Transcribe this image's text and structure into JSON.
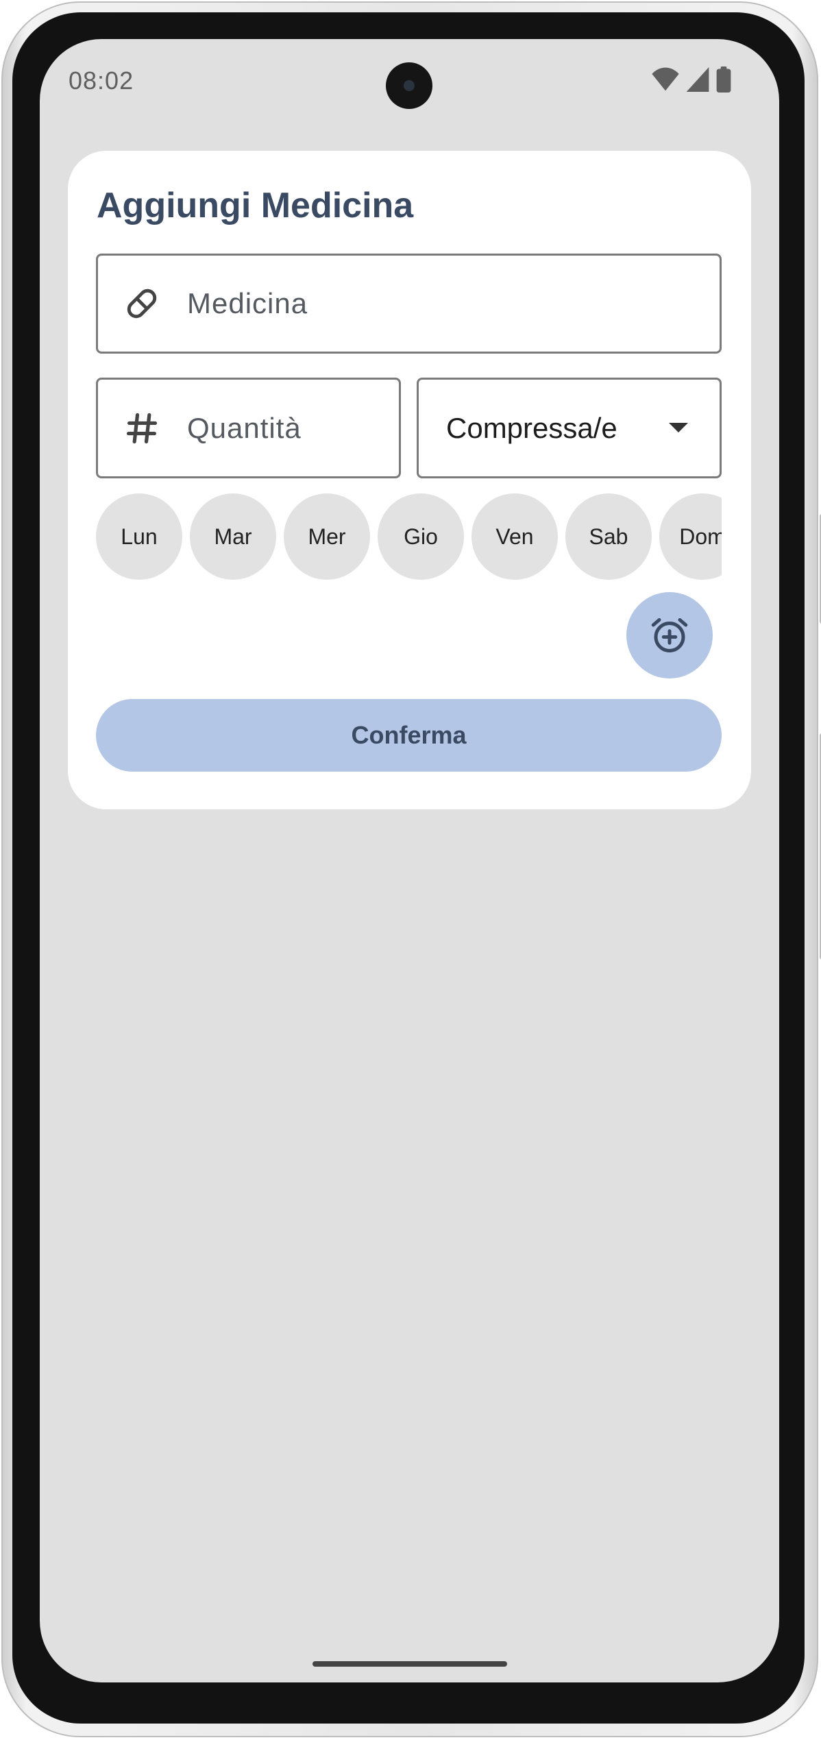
{
  "status_bar": {
    "time": "08:02",
    "icons": [
      "wifi-icon",
      "signal-icon",
      "battery-icon"
    ]
  },
  "dialog": {
    "title": "Aggiungi Medicina",
    "medicine_field": {
      "icon": "pill-icon",
      "placeholder": "Medicina",
      "value": ""
    },
    "quantity_field": {
      "icon": "hash-icon",
      "placeholder": "Quantità",
      "value": ""
    },
    "unit_select": {
      "selected": "Compressa/e",
      "icon": "dropdown-arrow-icon"
    },
    "days": [
      "Lun",
      "Mar",
      "Mer",
      "Gio",
      "Ven",
      "Sab",
      "Dom"
    ],
    "add_alarm_icon": "alarm-add-icon",
    "confirm_label": "Conferma"
  },
  "colors": {
    "accent": "#b3c6e6",
    "title": "#3b4a63",
    "screen_background": "#e0e0e0",
    "day_chip": "#e2e2e2"
  }
}
